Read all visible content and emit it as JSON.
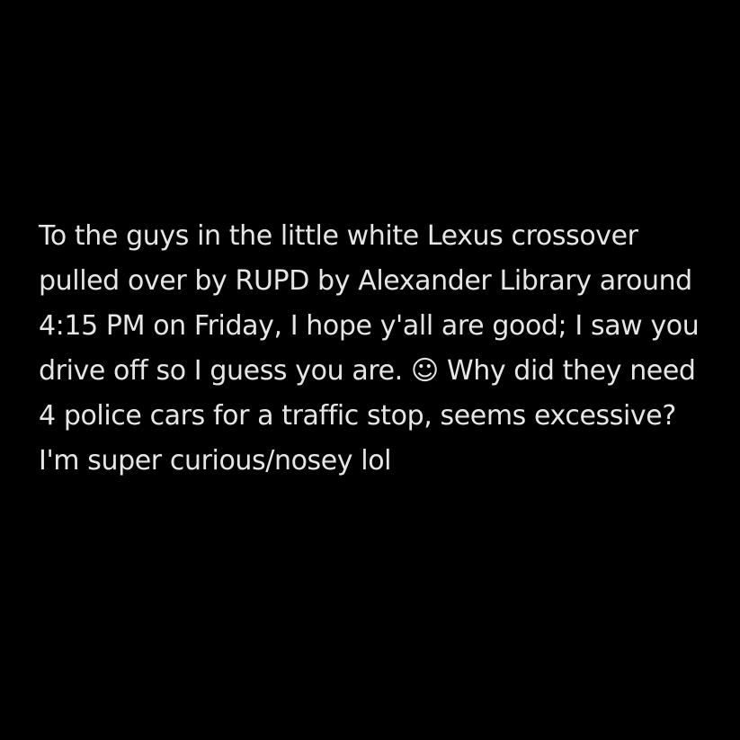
{
  "post": {
    "text": "To the guys in the little white Lexus crossover pulled over by RUPD by Alexander Library around 4:15 PM on Friday, I hope y'all are good; I saw you drive off so I guess you are. ☺ Why did they need 4 police cars for a traffic stop, seems excessive? I'm super curious/nosey lol"
  },
  "colors": {
    "background": "#000000",
    "text": "#e6e6e6"
  }
}
